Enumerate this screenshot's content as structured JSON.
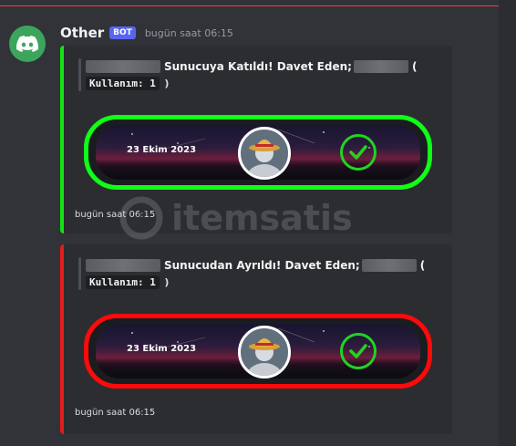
{
  "message": {
    "username": "Other",
    "bot_tag": "BOT",
    "timestamp": "bugün saat 06:15"
  },
  "embeds": [
    {
      "accent_color": "#12e312",
      "description": "Sunucuya Katıldı! Davet Eden;",
      "paren_open": "(",
      "code": "Kullanım: 1",
      "paren_close": ")",
      "banner_date": "23 Ekim 2023",
      "banner_border": "#0fff16",
      "footer": "bugün saat 06:15"
    },
    {
      "accent_color": "#e41b1b",
      "description": "Sunucudan Ayrıldı! Davet Eden;",
      "paren_open": "(",
      "code": "Kullanım: 1",
      "paren_close": ")",
      "banner_date": "23 Ekim 2023",
      "banner_border": "#ff0a0a",
      "footer": "bugün saat 06:15"
    }
  ],
  "watermark": "itemsatis",
  "icons": {
    "avatar": "discord-logo-icon",
    "check": "check-circle-icon",
    "profile": "strawhat-avatar-icon"
  }
}
